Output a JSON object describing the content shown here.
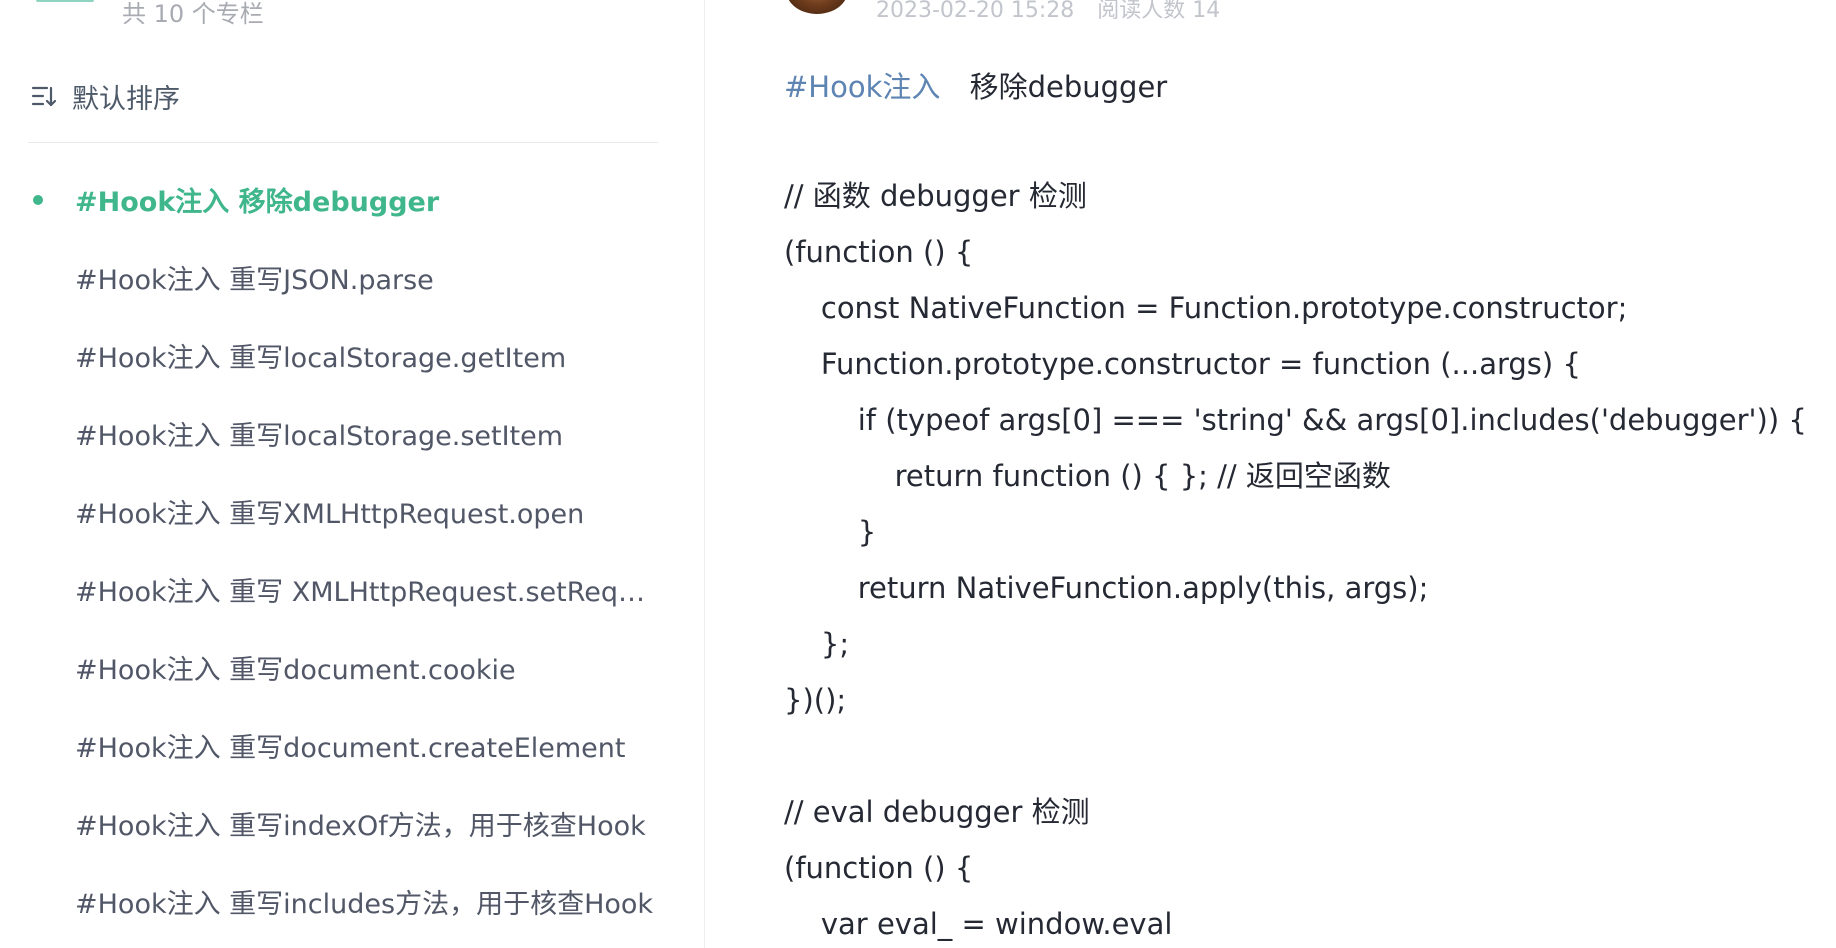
{
  "sidebar": {
    "column_count": "共 10 个专栏",
    "sort_label": "默认排序",
    "sort_icon": "sort-lines-icon",
    "items": [
      {
        "label": "#Hook注入 移除debugger",
        "active": true
      },
      {
        "label": "#Hook注入 重写JSON.parse",
        "active": false
      },
      {
        "label": "#Hook注入 重写localStorage.getItem",
        "active": false
      },
      {
        "label": "#Hook注入 重写localStorage.setItem",
        "active": false
      },
      {
        "label": "#Hook注入 重写XMLHttpRequest.open",
        "active": false
      },
      {
        "label": "#Hook注入 重写 XMLHttpRequest.setRequestHeader",
        "active": false
      },
      {
        "label": "#Hook注入 重写document.cookie",
        "active": false
      },
      {
        "label": "#Hook注入 重写document.createElement",
        "active": false
      },
      {
        "label": "#Hook注入 重写indexOf方法，用于核查Hook",
        "active": false
      },
      {
        "label": "#Hook注入 重写includes方法，用于核查Hook",
        "active": false
      }
    ]
  },
  "article": {
    "meta": {
      "date": "2023-02-20 15:28",
      "read_count": "阅读人数 14"
    },
    "title": {
      "hashtag": "#Hook注入",
      "text": "移除debugger"
    },
    "code": [
      "// 函数 debugger 检测",
      "(function () {",
      "    const NativeFunction = Function.prototype.constructor;",
      "    Function.prototype.constructor = function (...args) {",
      "        if (typeof args[0] === 'string' && args[0].includes('debugger')) {",
      "            return function () { }; // 返回空函数",
      "        }",
      "        return NativeFunction.apply(this, args);",
      "    };",
      "})();",
      "",
      "// eval debugger 检测",
      "(function () {",
      "    var eval_ = window.eval"
    ]
  },
  "colors": {
    "accent": "#3fb68b",
    "hashtag": "#5d84b2",
    "text": "#252933",
    "muted": "#a8abb2"
  }
}
